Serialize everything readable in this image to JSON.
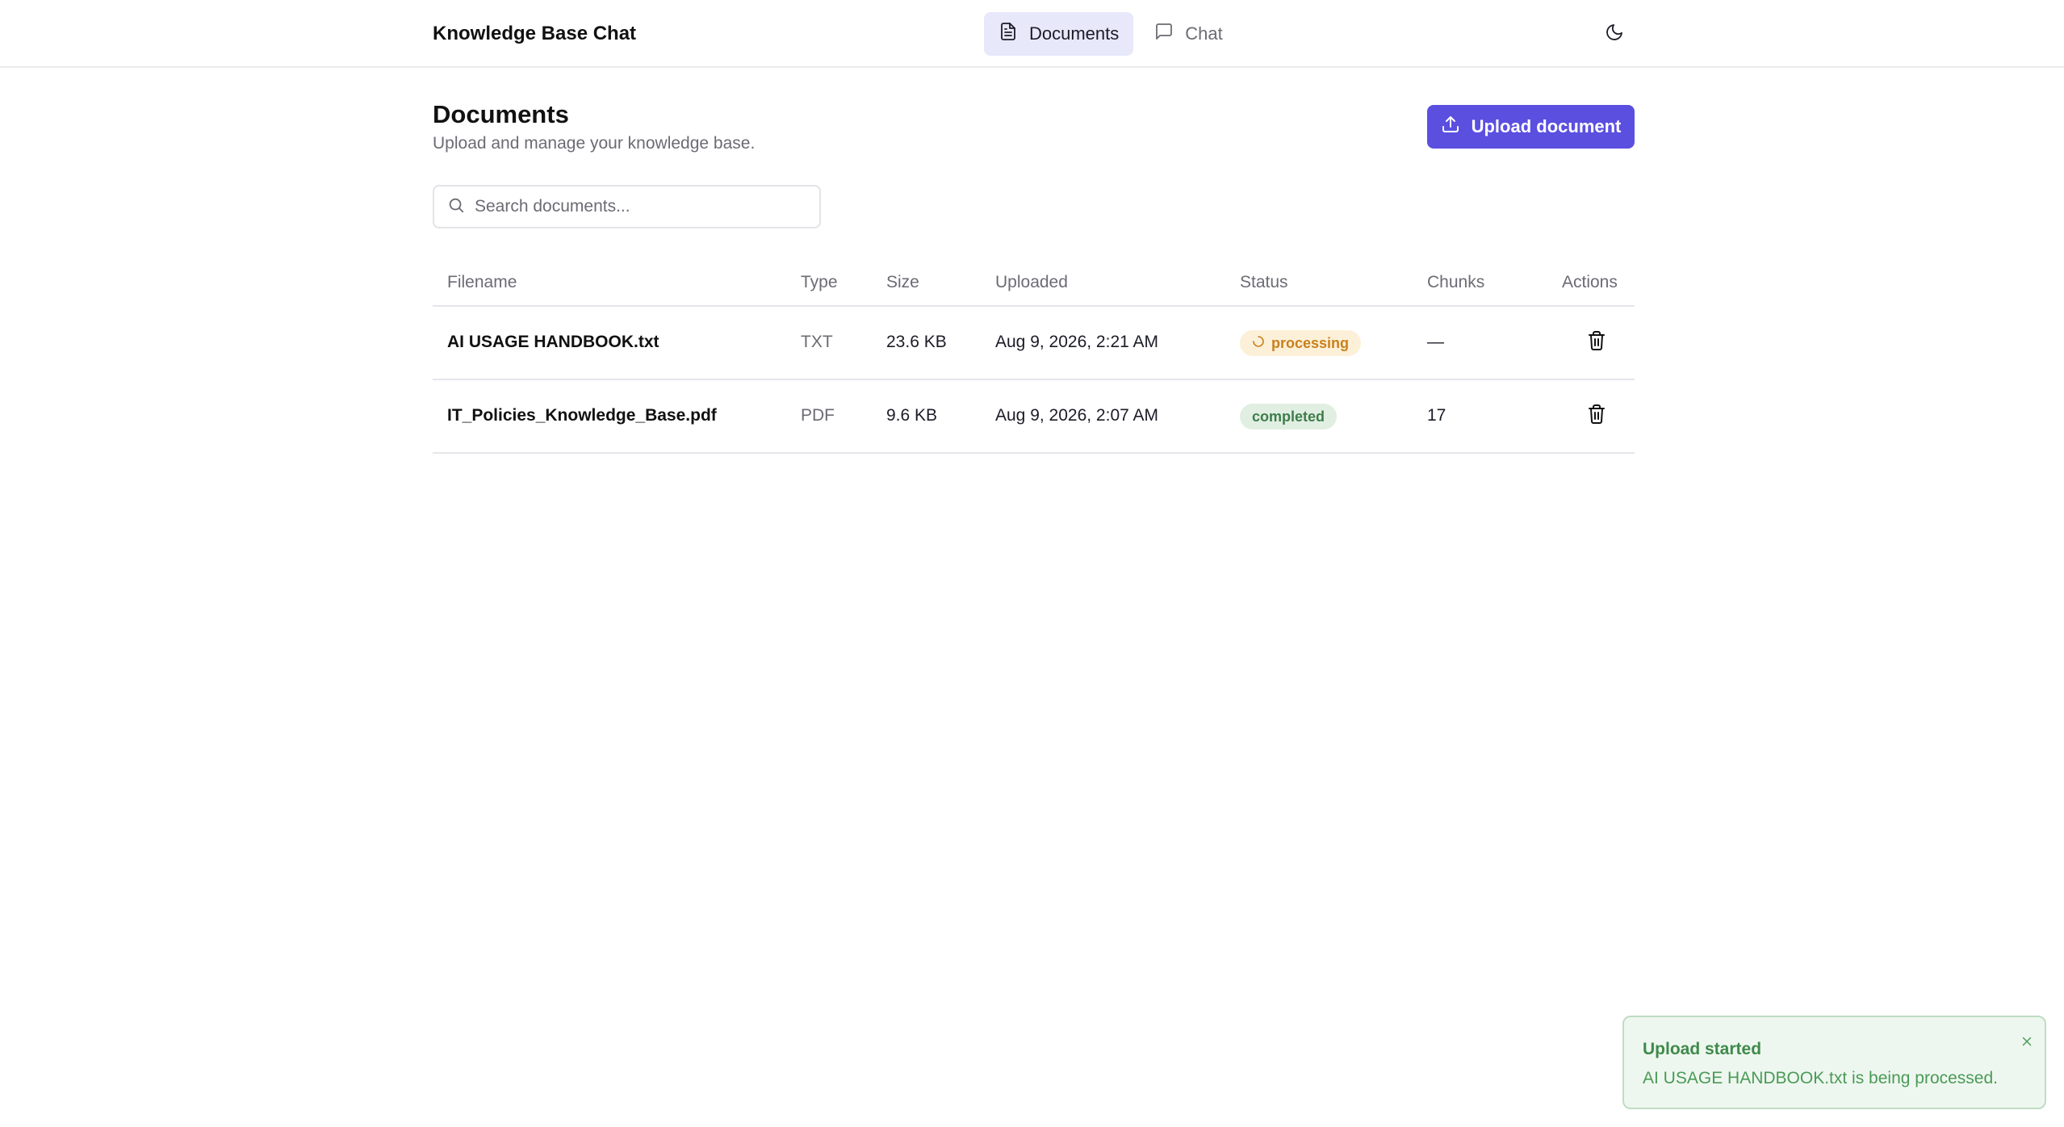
{
  "header": {
    "app_title": "Knowledge Base Chat",
    "tabs": [
      {
        "label": "Documents",
        "icon": "document-icon",
        "active": true
      },
      {
        "label": "Chat",
        "icon": "chat-bubble-icon",
        "active": false
      }
    ],
    "theme_toggle_icon": "moon-icon"
  },
  "page": {
    "title": "Documents",
    "subtitle": "Upload and manage your knowledge base.",
    "upload_label": "Upload document",
    "search": {
      "placeholder": "Search documents...",
      "value": ""
    }
  },
  "table": {
    "columns": [
      "Filename",
      "Type",
      "Size",
      "Uploaded",
      "Status",
      "Chunks",
      "Actions"
    ],
    "rows": [
      {
        "filename": "AI USAGE HANDBOOK.txt",
        "type": "TXT",
        "size": "23.6 KB",
        "uploaded": "Aug 9, 2026, 2:21 AM",
        "status": "processing",
        "chunks": "—"
      },
      {
        "filename": "IT_Policies_Knowledge_Base.pdf",
        "type": "PDF",
        "size": "9.6 KB",
        "uploaded": "Aug 9, 2026, 2:07 AM",
        "status": "completed",
        "chunks": "17"
      }
    ]
  },
  "toast": {
    "title": "Upload started",
    "message": "AI USAGE HANDBOOK.txt is being processed."
  },
  "colors": {
    "accent": "#5b4fe0",
    "processing": "#c9801b",
    "completed": "#3e7c4a",
    "toast": "#3e8a4b"
  }
}
